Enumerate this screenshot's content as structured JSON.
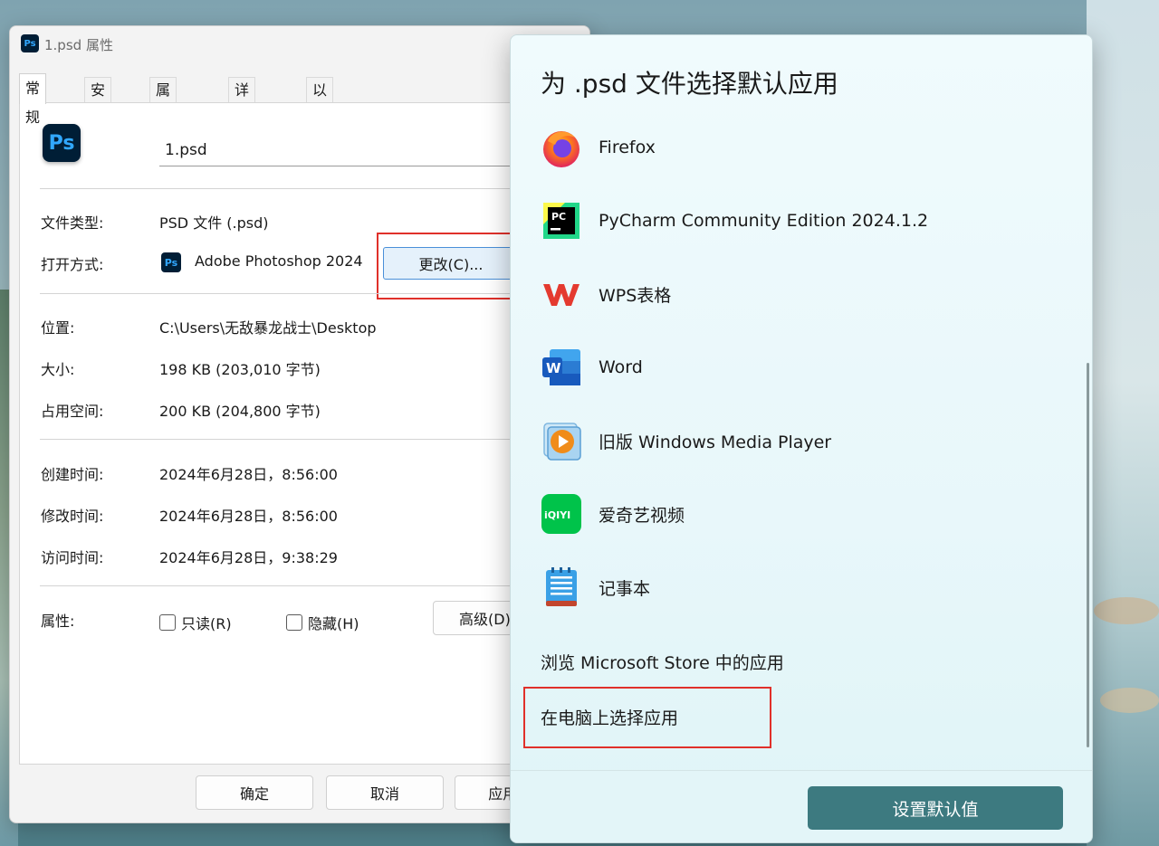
{
  "properties_window": {
    "title": "1.psd 属性",
    "tabs": [
      "常规",
      "安全",
      "属性修改",
      "详细信息",
      "以前的版本"
    ],
    "file_name": "1.psd",
    "rows": {
      "file_type_label": "文件类型:",
      "file_type_value": "PSD 文件 (.psd)",
      "open_with_label": "打开方式:",
      "open_with_value": "Adobe Photoshop 2024",
      "change_button": "更改(C)...",
      "location_label": "位置:",
      "location_value": "C:\\Users\\无敌暴龙战士\\Desktop",
      "size_label": "大小:",
      "size_value": "198 KB (203,010 字节)",
      "disk_label": "占用空间:",
      "disk_value": "200 KB (204,800 字节)",
      "created_label": "创建时间:",
      "created_value": "2024年6月28日，8:56:00",
      "modified_label": "修改时间:",
      "modified_value": "2024年6月28日，8:56:00",
      "accessed_label": "访问时间:",
      "accessed_value": "2024年6月28日，9:38:29",
      "attributes_label": "属性:",
      "readonly_label": "只读(R)",
      "hidden_label": "隐藏(H)",
      "advanced_button": "高级(D)..."
    },
    "ok_button": "确定",
    "cancel_button": "取消",
    "apply_button": "应用(A)",
    "ps_icon_text": "Ps"
  },
  "open_with": {
    "title": "为 .psd 文件选择默认应用",
    "apps": [
      {
        "name": "Firefox",
        "icon": "firefox-icon"
      },
      {
        "name": "PyCharm Community Edition 2024.1.2",
        "icon": "pycharm-icon"
      },
      {
        "name": "WPS表格",
        "icon": "wps-icon"
      },
      {
        "name": "Word",
        "icon": "word-icon"
      },
      {
        "name": "旧版 Windows Media Player",
        "icon": "media-player-icon"
      },
      {
        "name": "爱奇艺视频",
        "icon": "iqiyi-icon"
      },
      {
        "name": "记事本",
        "icon": "notepad-icon"
      }
    ],
    "icon_text": {
      "pycharm": "PC",
      "word": "W",
      "iqiyi": "iQIYI"
    },
    "store_link": "浏览 Microsoft Store 中的应用",
    "pc_link": "在电脑上选择应用",
    "set_default_button": "设置默认值"
  },
  "colors": {
    "highlight_box": "#e0302a",
    "primary_button": "#3d7a80",
    "photoshop_bg": "#001e36",
    "photoshop_fg": "#31a8ff"
  }
}
